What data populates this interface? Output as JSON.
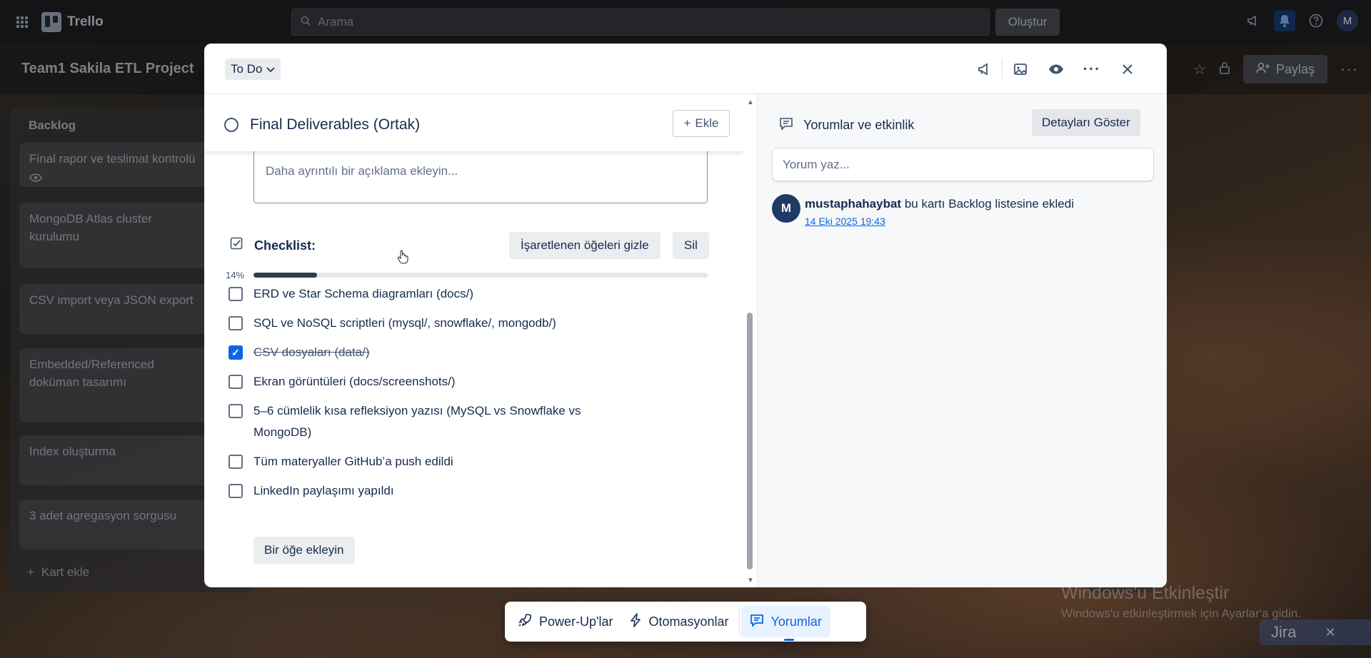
{
  "topbar": {
    "app_name": "Trello",
    "search_placeholder": "Arama",
    "create_label": "Oluştur",
    "user_initial": "M"
  },
  "board": {
    "title": "Team1 Sakila ETL Project",
    "share_label": "Paylaş",
    "list": {
      "title": "Backlog",
      "cards": [
        "Final rapor ve teslimat kontrolü",
        "MongoDB Atlas cluster kurulumu",
        "CSV import veya JSON export",
        "Embedded/Referenced doküman tasarımı",
        "Index oluşturma",
        "3 adet agregasyon sorgusu"
      ],
      "add_card_label": "Kart ekle"
    }
  },
  "modal": {
    "status": "To Do",
    "card_title": "Final Deliverables (Ortak)",
    "add_label": "Ekle",
    "description_placeholder": "Daha ayrıntılı bir açıklama ekleyin...",
    "checklist": {
      "title": "Checklist:",
      "hide_checked_label": "İşaretlenen öğeleri gizle",
      "delete_label": "Sil",
      "progress_label": "14%",
      "progress": 0.14,
      "items": [
        {
          "text": "ERD ve Star Schema diagramları (docs/)",
          "checked": false
        },
        {
          "text": "SQL ve NoSQL scriptleri (mysql/, snowflake/, mongodb/)",
          "checked": false
        },
        {
          "text": "CSV dosyaları (data/)",
          "checked": true
        },
        {
          "text": "Ekran görüntüleri (docs/screenshots/)",
          "checked": false
        },
        {
          "text": "5–6 cümlelik kısa refleksiyon yazısı (MySQL vs Snowflake vs MongoDB)",
          "checked": false
        },
        {
          "text": "Tüm materyaller GitHub’a push edildi",
          "checked": false
        },
        {
          "text": "LinkedIn paylaşımı yapıldı",
          "checked": false
        }
      ],
      "add_item_label": "Bir öğe ekleyin"
    },
    "comments": {
      "title": "Yorumlar ve etkinlik",
      "details_label": "Detayları Göster",
      "input_placeholder": "Yorum yaz...",
      "activity": {
        "avatar_initial": "M",
        "user": "mustaphahaybat",
        "action": " bu kartı Backlog listesine ekledi",
        "timestamp": "14 Eki 2025 19:43"
      }
    }
  },
  "dock": {
    "powerups_label": "Power-Up'lar",
    "automations_label": "Otomasyonlar",
    "comments_label": "Yorumlar"
  },
  "windows": {
    "activate_title": "Windows'u Etkinleştir",
    "activate_text": "Windows'u etkinleştirmek için Ayarlar'a gidin."
  },
  "jira": {
    "label": "Jira"
  },
  "colors": {
    "accent": "#0c66e4",
    "progress_fill": "#2c3e50",
    "checked_box": "#0c66e4"
  }
}
